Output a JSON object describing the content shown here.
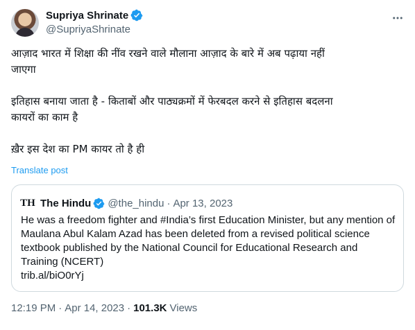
{
  "author": {
    "display_name": "Supriya Shrinate",
    "handle": "@SupriyaShrinate",
    "verified": true
  },
  "icons": {
    "verified": "verified-badge-icon",
    "more": "more-options-icon",
    "quote_logo": "the-hindu-logo-icon"
  },
  "tweet": {
    "paragraphs": [
      "आज़ाद भारत में शिक्षा की नींव रखने वाले मौलाना आज़ाद के बारे में अब पढ़ाया नहीं\nजाएगा",
      "इतिहास बनाया जाता है - किताबों और पाठ्यक्रमों में फेरबदल करने से इतिहास बदलना\nकायरों का काम है",
      "ख़ैर इस देश का PM कायर तो है ही"
    ],
    "translate_label": "Translate post"
  },
  "quote": {
    "logo_text": "TH",
    "name": "The Hindu",
    "handle": "@the_hindu",
    "separator": "·",
    "date": "Apr 13, 2023",
    "text": "He was a freedom fighter and #India’s first Education Minister, but any mention of Maulana Abul Kalam Azad has been deleted from a revised political science textbook published by the National Council for Educational Research and Training (NCERT)",
    "link": "trib.al/biO0rYj"
  },
  "footer": {
    "time": "12:19 PM",
    "separator": "·",
    "date": "Apr 14, 2023",
    "views_count": "101.3K",
    "views_label": "Views"
  },
  "colors": {
    "accent": "#1d9bf0",
    "text": "#0f1419",
    "secondary": "#536471",
    "border": "#cfd9de"
  }
}
